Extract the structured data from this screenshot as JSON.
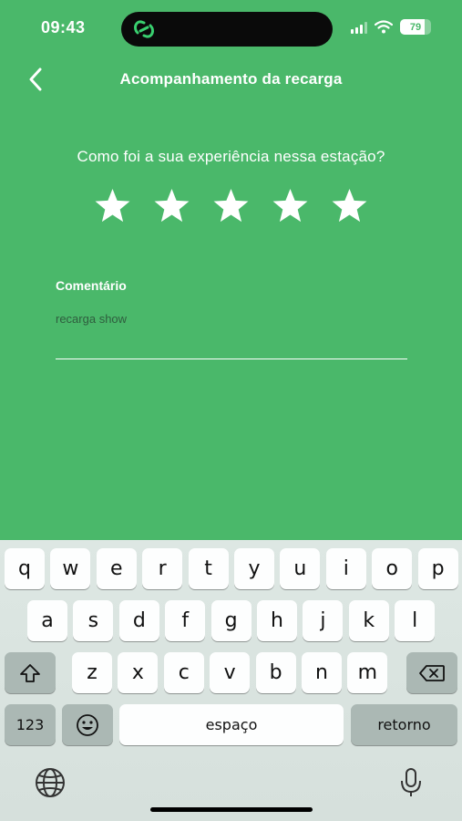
{
  "status_bar": {
    "time": "09:43",
    "battery": "79",
    "battery_level_percent": 79
  },
  "header": {
    "title": "Acompanhamento da recarga",
    "back_icon": "chevron-left-icon"
  },
  "rating": {
    "question": "Como foi a sua experiência nessa estação?",
    "max_stars": 5,
    "selected_stars": 5
  },
  "comment": {
    "label": "Comentário",
    "value": "recarga show"
  },
  "keyboard": {
    "row1": [
      "q",
      "w",
      "e",
      "r",
      "t",
      "y",
      "u",
      "i",
      "o",
      "p"
    ],
    "row2": [
      "a",
      "s",
      "d",
      "f",
      "g",
      "h",
      "j",
      "k",
      "l"
    ],
    "row3": [
      "z",
      "x",
      "c",
      "v",
      "b",
      "n",
      "m"
    ],
    "numbers_key": "123",
    "space_key": "espaço",
    "return_key": "retorno",
    "shift_icon": "shift-icon",
    "delete_icon": "backspace-icon",
    "emoji_icon": "emoji-icon",
    "globe_icon": "globe-icon",
    "mic_icon": "microphone-icon"
  },
  "colors": {
    "background": "#4ab86a",
    "keyboard": "#dde7e3"
  }
}
